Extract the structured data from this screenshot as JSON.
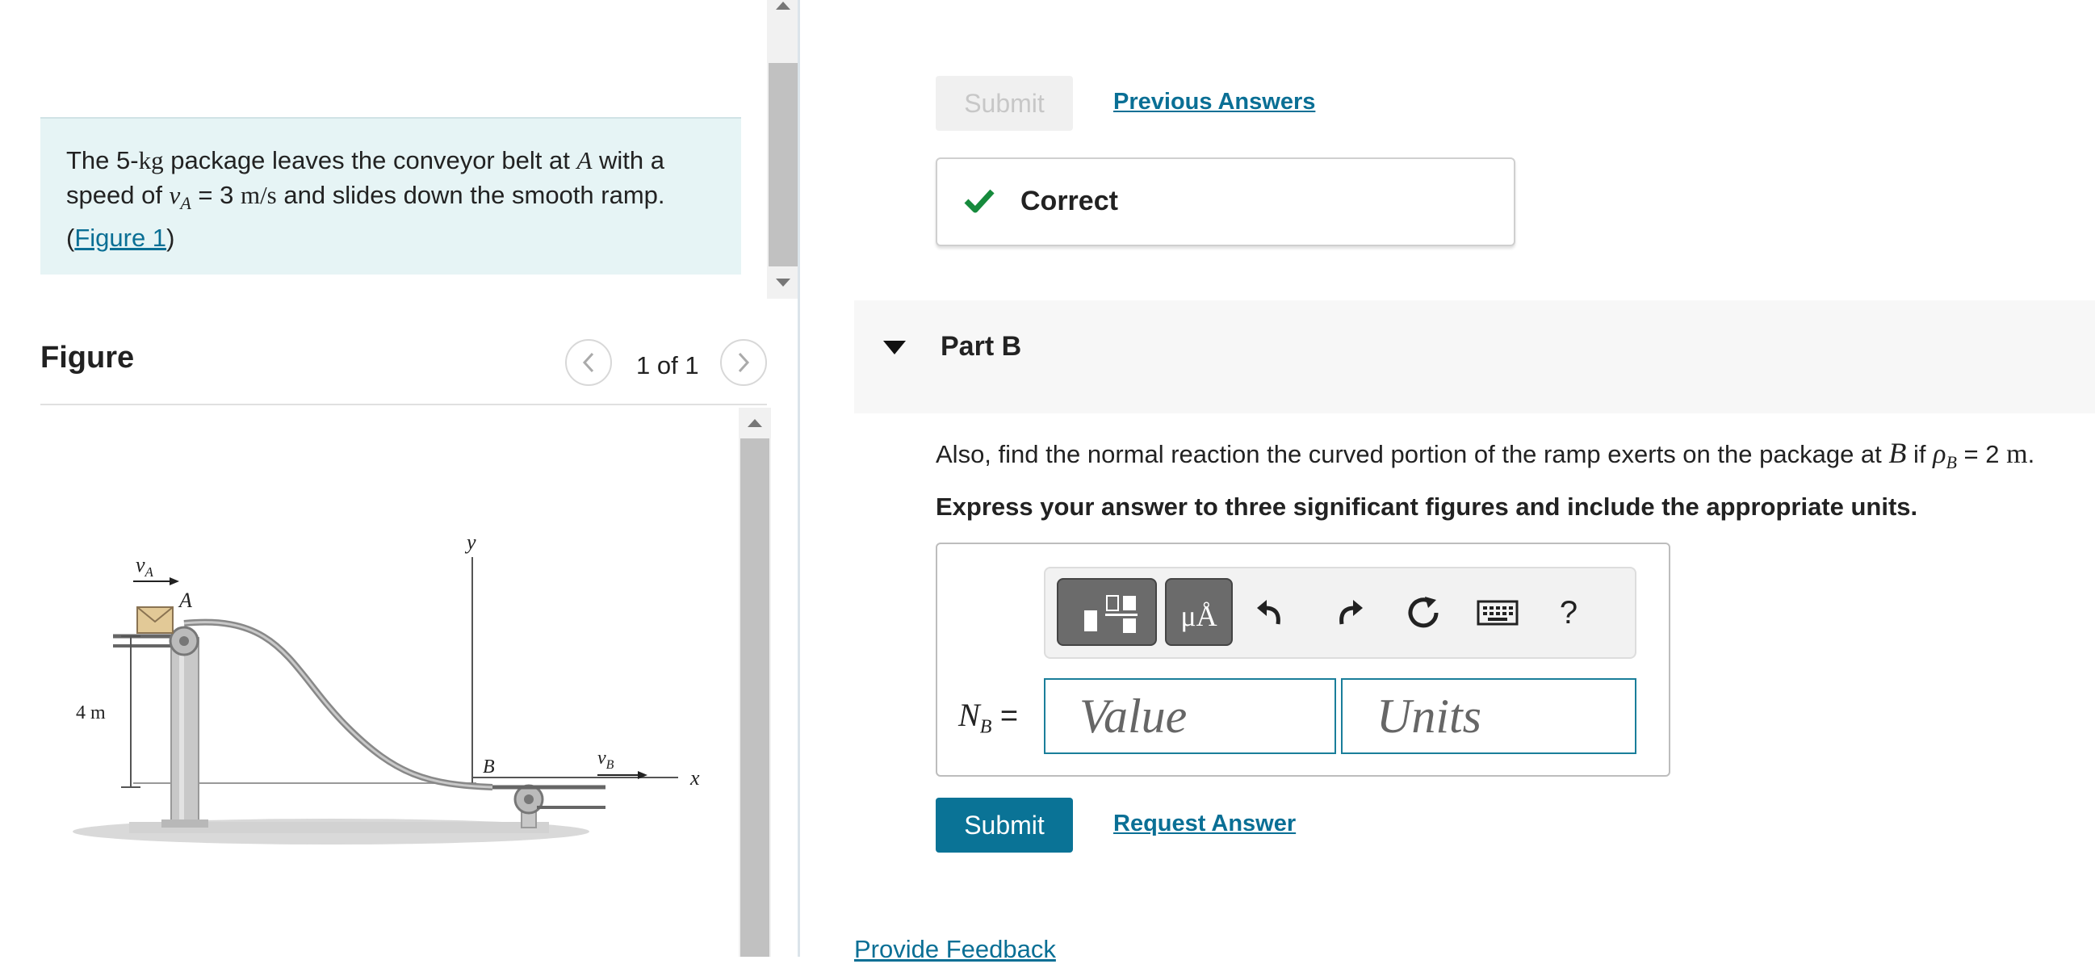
{
  "problem": {
    "text_before_mass": "The 5-",
    "mass_unit": "kg",
    "text_after_mass": " package leaves the conveyor belt at ",
    "point_a": "A",
    "text_with": " with a speed of ",
    "speed_symbol": "v",
    "speed_sub": "A",
    "speed_value": " = 3 ",
    "speed_unit": "m/s",
    "text_end": " and slides down the smooth ramp. (",
    "figure_link": "Figure 1",
    "text_close": ")"
  },
  "figure": {
    "title": "Figure",
    "pager_count": "1 of 1",
    "labels": {
      "vA": "v",
      "vA_sub": "A",
      "A": "A",
      "y": "y",
      "height": "4 m",
      "B": "B",
      "vB": "v",
      "vB_sub": "B",
      "x": "x"
    }
  },
  "part_a": {
    "submit_label": "Submit",
    "previous_answers_label": "Previous Answers",
    "status_label": "Correct"
  },
  "part_b": {
    "label": "Part B",
    "question_prefix": "Also, find the normal reaction the curved portion of the ramp exerts on the package at ",
    "question_point": "B",
    "question_if": " if ",
    "rho_symbol": "ρ",
    "rho_sub": "B",
    "question_value": " = 2 ",
    "question_unit": "m",
    "question_end": ".",
    "instruction": "Express your answer to three significant figures and include the appropriate units.",
    "answer_var": "N",
    "answer_sub": "B",
    "answer_eq": " =",
    "value_placeholder": "Value",
    "units_placeholder": "Units",
    "units_button_label": "μÅ",
    "help_label": "?",
    "submit_label": "Submit",
    "request_answer_label": "Request Answer"
  },
  "footer": {
    "feedback_label": "Provide Feedback"
  },
  "colors": {
    "accent": "#0a7396",
    "link": "#0a6f95",
    "correct": "#168a3c",
    "problem_bg": "#e6f4f5"
  }
}
